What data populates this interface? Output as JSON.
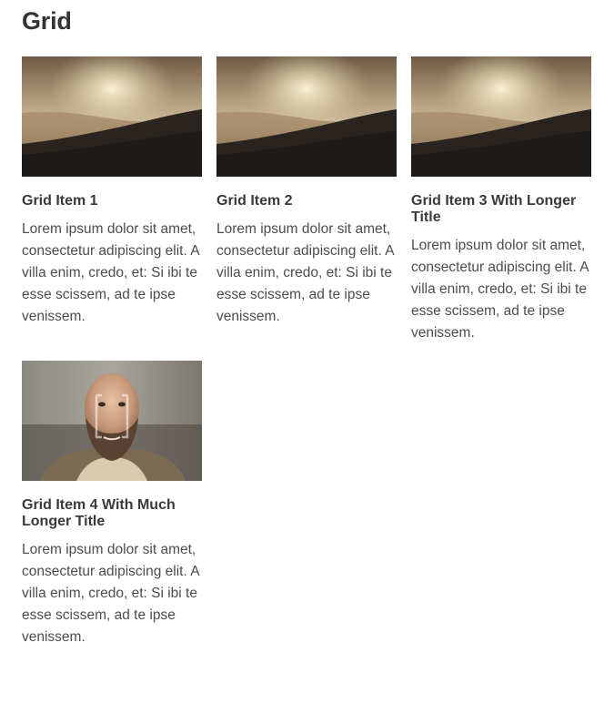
{
  "page": {
    "title": "Grid"
  },
  "items": [
    {
      "title": "Grid Item 1",
      "text": "Lorem ipsum dolor sit amet, consectetur adipiscing elit. A villa enim, credo, et: Si ibi te esse scissem, ad te ipse venissem.",
      "image": "landscape-sunset"
    },
    {
      "title": "Grid Item 2",
      "text": "Lorem ipsum dolor sit amet, consectetur adipiscing elit. A villa enim, credo, et: Si ibi te esse scissem, ad te ipse venissem.",
      "image": "landscape-sunset"
    },
    {
      "title": "Grid Item 3 With Longer Title",
      "text": "Lorem ipsum dolor sit amet, consectetur adipiscing elit. A villa enim, credo, et: Si ibi te esse scissem, ad te ipse venissem.",
      "image": "landscape-sunset"
    },
    {
      "title": "Grid Item 4 With Much Longer Title",
      "text": "Lorem ipsum dolor sit amet, consectetur adipiscing elit. A villa enim, credo, et: Si ibi te esse scissem, ad te ipse venissem.",
      "image": "portrait-bearded-man"
    }
  ]
}
